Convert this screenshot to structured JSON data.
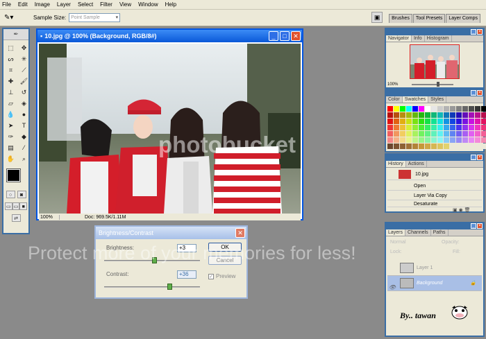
{
  "menu": [
    "File",
    "Edit",
    "Image",
    "Layer",
    "Select",
    "Filter",
    "View",
    "Window",
    "Help"
  ],
  "options": {
    "sample_size_label": "Sample Size:",
    "sample_size_value": "Point Sample"
  },
  "well_tabs": [
    "Brushes",
    "Tool Presets",
    "Layer Comps"
  ],
  "document": {
    "title": "10.jpg @ 100% (Background, RGB/8#)",
    "zoom": "100%",
    "doc_size": "Doc: 969.5K/1.11M"
  },
  "dialog": {
    "title": "Brightness/Contrast",
    "brightness_label": "Brightness:",
    "brightness_value": "+3",
    "brightness_level": 0.52,
    "contrast_label": "Contrast:",
    "contrast_value": "+36",
    "contrast_level": 0.68,
    "ok_label": "OK",
    "cancel_label": "Cancel",
    "preview_label": "Preview"
  },
  "navigator": {
    "tabs": [
      "Navigator",
      "Info",
      "Histogram"
    ],
    "zoom": "100%"
  },
  "swatches": {
    "tabs": [
      "Color",
      "Swatches",
      "Styles"
    ]
  },
  "history": {
    "tabs": [
      "History",
      "Actions"
    ],
    "snapshot": "10.jpg",
    "items": [
      "Open",
      "Layer Via Copy",
      "Desaturate"
    ]
  },
  "layers": {
    "tabs": [
      "Layers",
      "Channels",
      "Paths"
    ],
    "blend_mode": "Normal",
    "opacity_label": "Opacity:",
    "lock_label": "Lock:",
    "fill_label": "Fill:",
    "items": [
      "Layer 1",
      "Background"
    ]
  },
  "credit": "By.. tawan",
  "watermark": {
    "logo_text": "photobucket",
    "protect_text": "Protect more of your memories for less!"
  },
  "colors": {
    "title_blue": "#0a58d8",
    "panel_bg": "#ece9d8",
    "workspace": "#8a8a8a",
    "layer_selected": "#a9bfe6"
  }
}
